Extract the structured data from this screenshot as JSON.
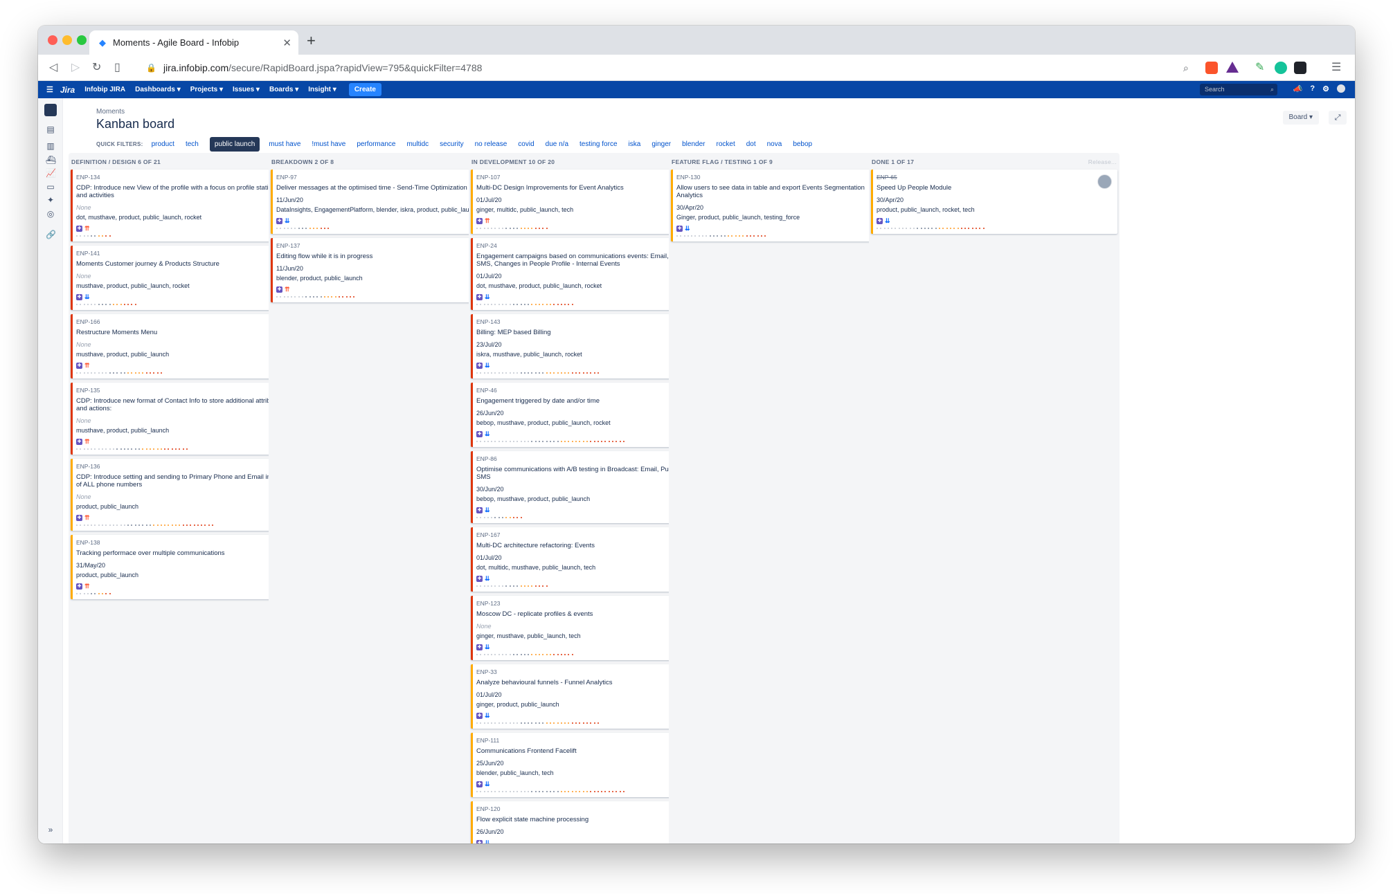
{
  "browser": {
    "tab_title": "Moments - Agile Board - Infobip",
    "url_host": "jira.infobip.com",
    "url_path": "/secure/RapidBoard.jspa?rapidView=795&quickFilter=4788",
    "icons": [
      "back-icon",
      "forward-icon",
      "reload-icon",
      "bookmark-icon",
      "lock-icon",
      "zoom-icon",
      "brave-shields-icon",
      "brave-rewards-icon",
      "pen-extension-icon",
      "grammarly-icon",
      "react-devtools-icon",
      "menu-icon"
    ]
  },
  "jira_nav": {
    "brand": "Jira",
    "site": "Infobip JIRA",
    "menus": [
      "Dashboards",
      "Projects",
      "Issues",
      "Boards",
      "Insight"
    ],
    "create": "Create",
    "search_placeholder": "Search"
  },
  "board": {
    "breadcrumb": "Moments",
    "title": "Kanban board",
    "board_button": "Board",
    "quick_filters_label": "QUICK FILTERS:",
    "quick_filters": [
      "product",
      "tech",
      "public launch",
      "must have",
      "!must have",
      "performance",
      "multidc",
      "security",
      "no release",
      "covid",
      "due n/a",
      "testing force",
      "iska",
      "ginger",
      "blender",
      "rocket",
      "dot",
      "nova",
      "bebop"
    ],
    "active_filter": "public launch"
  },
  "columns": [
    {
      "header": "DEFINITION / DESIGN 6 OF 21",
      "cards": [
        {
          "key": "ENP-134",
          "title": "CDP: Introduce new View of the profile with a focus on profile static data and activities",
          "date": "None",
          "labels": "dot, musthave, product, public_launch, rocket",
          "pri": "high"
        },
        {
          "key": "ENP-141",
          "title": "Moments Customer journey & Products Structure",
          "date": "None",
          "labels": "musthave, product, public_launch, rocket",
          "pri": "low"
        },
        {
          "key": "ENP-166",
          "title": "Restructure Moments Menu",
          "date": "None",
          "labels": "musthave, product, public_launch",
          "pri": "high"
        },
        {
          "key": "ENP-135",
          "title": "CDP: Introduce new format of Contact Info to store additional attributes and actions:",
          "date": "None",
          "labels": "musthave, product, public_launch",
          "pri": "high"
        },
        {
          "key": "ENP-136",
          "title": "CDP: Introduce setting and sending to Primary Phone and Email instead of ALL phone numbers",
          "date": "None",
          "labels": "product, public_launch",
          "pri": "high"
        },
        {
          "key": "ENP-138",
          "title": "Tracking performace over multiple communications",
          "date": "31/May/20",
          "labels": "product, public_launch",
          "pri": "high"
        }
      ]
    },
    {
      "header": "BREAKDOWN 2 OF 8",
      "cards": [
        {
          "key": "ENP-97",
          "title": "Deliver messages at the optimised time - Send-Time Optimization (STO)",
          "date": "11/Jun/20",
          "labels": "DataInsights, EngagementPlatform, blender, iskra, product, public_launch",
          "pri": "low"
        },
        {
          "key": "ENP-137",
          "title": "Editing flow while it is in progress",
          "date": "11/Jun/20",
          "labels": "blender, product, public_launch",
          "pri": "high"
        }
      ]
    },
    {
      "header": "IN DEVELOPMENT 10 OF 20",
      "cards": [
        {
          "key": "ENP-107",
          "title": "Multi-DC Design Improvements for Event Analytics",
          "date": "01/Jul/20",
          "labels": "ginger, multidc, public_launch, tech",
          "pri": "high"
        },
        {
          "key": "ENP-24",
          "title": "Engagement campaigns based on communications events: Email, Push, SMS, Changes in People Profile - Internal Events",
          "date": "01/Jul/20",
          "labels": "dot, musthave, product, public_launch, rocket",
          "pri": "low"
        },
        {
          "key": "ENP-143",
          "title": "Billing: MEP based Billing",
          "date": "23/Jul/20",
          "labels": "iskra, musthave, public_launch, rocket",
          "pri": "low"
        },
        {
          "key": "ENP-46",
          "title": "Engagement triggered by date and/or time",
          "date": "26/Jun/20",
          "labels": "bebop, musthave, product, public_launch, rocket",
          "pri": "low"
        },
        {
          "key": "ENP-86",
          "title": "Optimise communications with A/B testing in Broadcast: Email, Push and SMS",
          "date": "30/Jun/20",
          "labels": "bebop, musthave, product, public_launch",
          "pri": "low"
        },
        {
          "key": "ENP-167",
          "title": "Multi-DC architecture refactoring: Events",
          "date": "01/Jul/20",
          "labels": "dot, multidc, musthave, public_launch, tech",
          "pri": "low"
        },
        {
          "key": "ENP-123",
          "title": "Moscow DC - replicate profiles & events",
          "date": "None",
          "labels": "ginger, musthave, public_launch, tech",
          "pri": "low"
        },
        {
          "key": "ENP-33",
          "title": "Analyze behavioural funnels - Funnel Analytics",
          "date": "01/Jul/20",
          "labels": "ginger, product, public_launch",
          "pri": "low"
        },
        {
          "key": "ENP-111",
          "title": "Communications Frontend Facelift",
          "date": "25/Jun/20",
          "labels": "blender, public_launch, tech",
          "pri": "low"
        },
        {
          "key": "ENP-120",
          "title": "Flow explicit state machine processing",
          "date": "26/Jun/20",
          "labels": "",
          "pri": "low"
        }
      ]
    },
    {
      "header": "FEATURE FLAG / TESTING 1 OF 9",
      "cards": [
        {
          "key": "ENP-130",
          "title": "Allow users to see data in table and export Events Segmentation Analytics",
          "date": "30/Apr/20",
          "labels": "Ginger, product, public_launch, testing_force",
          "pri": "low"
        }
      ]
    },
    {
      "header": "DONE 1 OF 17",
      "release": "Release...",
      "cards": [
        {
          "key": "ENP-65",
          "title": "Speed Up People Module",
          "date": "30/Apr/20",
          "labels": "product, public_launch, rocket, tech",
          "pri": "low"
        }
      ]
    }
  ],
  "colors": {
    "nav": "#0747a6",
    "create": "#2684ff",
    "story": "#6554c0",
    "red_border": "#de350b",
    "yellow_border": "#ffab00",
    "filter_active": "#253858"
  }
}
